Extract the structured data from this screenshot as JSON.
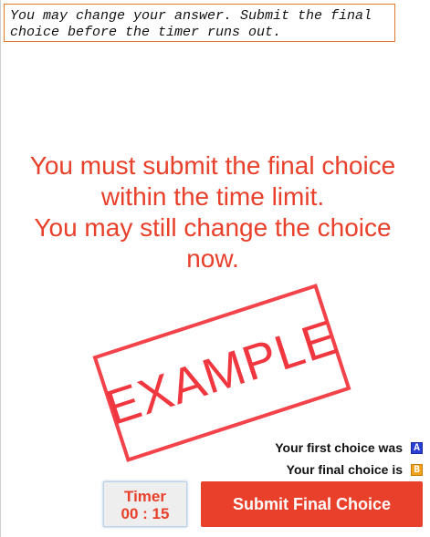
{
  "instructions": {
    "line1": "You may change your answer. Submit the final",
    "line2": "choice before the timer runs out."
  },
  "message": {
    "line1": "You must submit the final choice",
    "line2": "within the time limit.",
    "line3": "You may still change the choice",
    "line4": "now."
  },
  "stamp": {
    "text": "EXAMPLE"
  },
  "choices": {
    "first_label": "Your first choice was",
    "first_value": "A",
    "final_label": "Your final choice is",
    "final_value": "B"
  },
  "timer": {
    "label": "Timer",
    "value": "00 : 15"
  },
  "submit_button": {
    "label": "Submit Final Choice"
  },
  "colors": {
    "accent_red": "#e8402a",
    "stamp_red": "#f2424a",
    "instructions_border": "#e07a2e",
    "choice_a_badge": "#2a3fd6",
    "choice_b_badge": "#f2a21c"
  }
}
